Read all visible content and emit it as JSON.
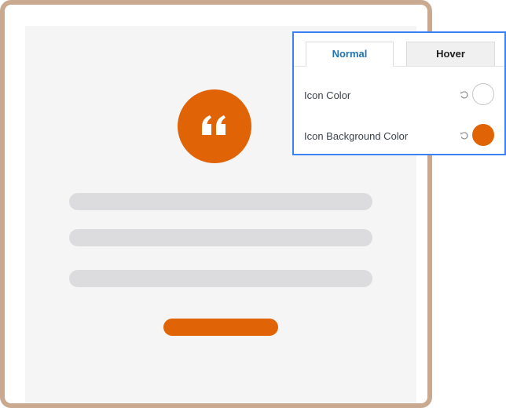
{
  "panel": {
    "tabs": [
      {
        "label": "Normal",
        "active": true
      },
      {
        "label": "Hover",
        "active": false
      }
    ],
    "settings": [
      {
        "label": "Icon Color",
        "value": "#ffffff",
        "reset_icon": "reset-icon"
      },
      {
        "label": "Icon Background Color",
        "value": "#e06305",
        "reset_icon": "reset-icon"
      }
    ]
  },
  "preview": {
    "quote_icon": "quote-icon",
    "accent_color": "#e06305",
    "frame_color": "#c9aa91"
  },
  "colors": {
    "panel_border": "#3b82f6",
    "active_tab_text": "#2271b1",
    "skeleton": "#dcdcde",
    "canvas": "#f5f5f5"
  }
}
